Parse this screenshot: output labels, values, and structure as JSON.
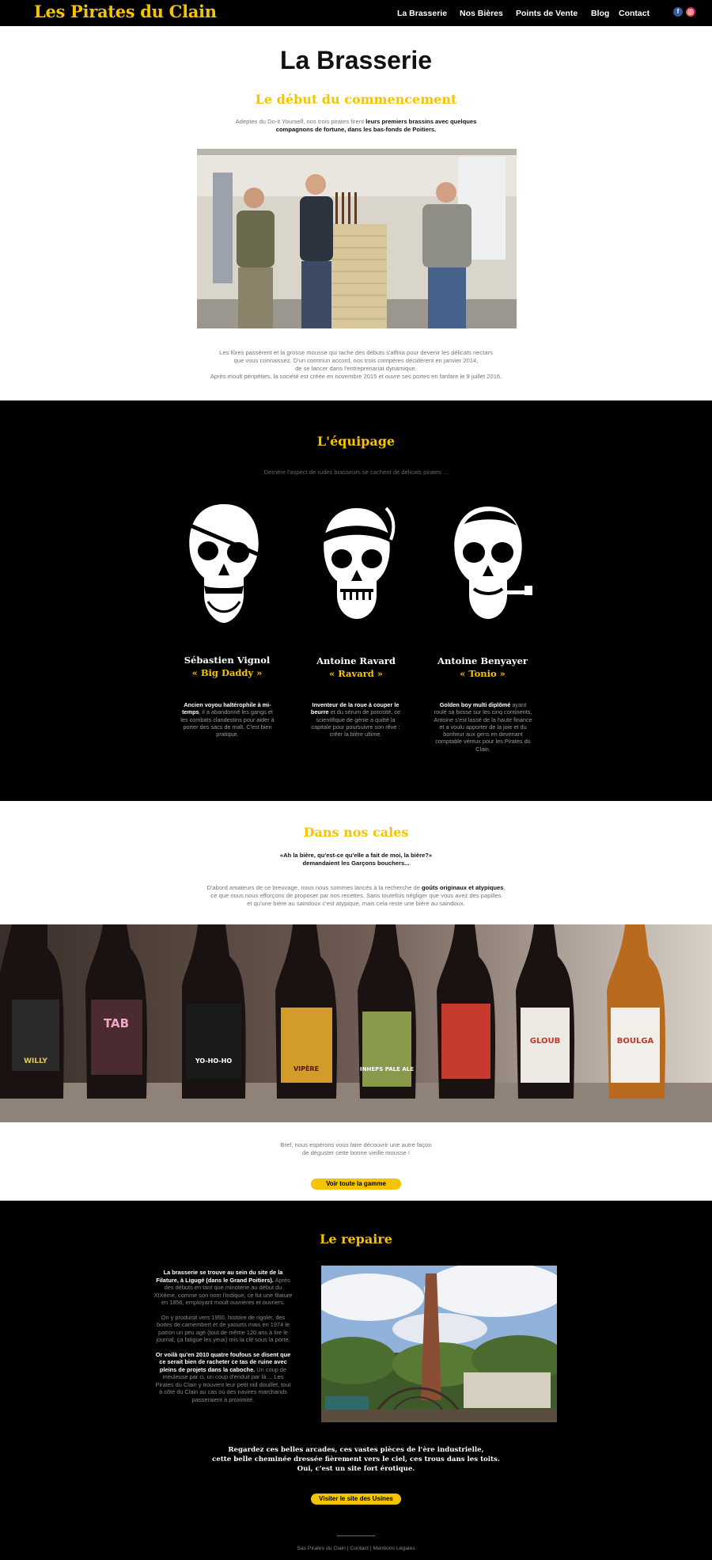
{
  "header": {
    "logo": "Les Pirates du Clain",
    "nav": [
      "La Brasserie",
      "Nos Bières",
      "Points de Vente",
      "Blog",
      "Contact"
    ],
    "social": [
      "facebook-icon",
      "instagram-icon"
    ]
  },
  "brasserie": {
    "title": "La Brasserie",
    "subtitle": "Le début du commencement",
    "intro_a": "Adeptes du Do-it Yourself, nos trois pirates firent ",
    "intro_b": "leurs premiers brassins avec quelques",
    "intro_c": "compagnons de fortune, dans les bas-fonds de Poitiers.",
    "story": [
      "Les fûres passèrent et la grosse mousse qui tache des débuts s'affina pour devenir les délicats nectars",
      "que vous connaissez. D'un commun accord, nos trois compères décidèrent en janvier 2014,",
      "de se lancer dans l'entreprenariat dynamique.",
      "Après moult péripéties, la société est créée en novembre 2015 et ouvre ses portes en fanfare le 9 juillet 2016."
    ]
  },
  "equipage": {
    "title": "L'équipage",
    "subtitle": "Derrière l'aspect de rudes brasseurs se cachent de délicats pirates ...",
    "members": [
      {
        "name": "Sébastien Vignol",
        "nick": "« Big Daddy »",
        "bold": "Ancien voyou haltérophile à mi-temps",
        "desc": ", il a abandonné les gangs et les combats clandestins pour aider à porter des sacs de malt. C'est bien pratique."
      },
      {
        "name": "Antoine Ravard",
        "nick": "« Ravard »",
        "bold": "Inventeur de la roue à couper le beurre",
        "desc": " et du sérum de porosité, ce scientifique de génie a quitté la capitale pour poursuivre son rêve : créer la bière ultime."
      },
      {
        "name": "Antoine Benyayer",
        "nick": "« Tonio »",
        "bold": "Golden boy multi diplômé",
        "desc": " ayant roulé sa bosse sur les cinq continents, Antoine s'est lassé de la haute finance et a voulu apporter de la joie et du bonheur aux gens en devenant comptable véreux pour les Pirates du Clain."
      }
    ]
  },
  "cales": {
    "title": "Dans nos cales",
    "quote_1": "«Ah la bière, qu'est-ce qu'elle a fait de moi, la bière?»",
    "quote_2": "demandaient les Garçons bouchers...",
    "text_a": "D'abord amateurs de ce breuvage, nous nous sommes lancés à la recherche de ",
    "text_b": "goûts originaux et atypiques",
    "text_c": ",",
    "text_2": "ce que nous nous efforçons de proposer par nos recettes. Sans toutefois négliger que vous avez des papilles",
    "text_3": "et qu'une bière au saindoux c'est atypique, mais cela reste une bière au saindoux.",
    "bottles": [
      "WILLY",
      "TAB",
      "YO-HO-HO",
      "VIPÈRE",
      "INHEPS PALE ALE",
      "",
      "GLOUB",
      "BOULGA"
    ],
    "outro_1": "Bref, nous espérons vous faire découvrir une autre façon",
    "outro_2": "de déguster cette bonne vieille mousse !",
    "button": "Voir toute la gamme"
  },
  "repaire": {
    "title": "Le repaire",
    "p1_bold": "La brasserie se trouve au sein du site de la Filature, à Ligugé (dans le Grand Poitiers).",
    "p1": " Après des débuts en tant que minoterie au début du XIXème, comme son nom l'indique, ce fut une filature en 1856, employant moult ouvrières et ouvriers.",
    "p2": "On y produisit vers 1950, histoire de rigoler, des boites de camembert et de yaourts mais en 1974 le patron un peu agé (tout de même 120 ans à lire le journal, ça fatigue les yeux) mis la clé sous la porte.",
    "p3_bold": "Or voilà qu'en 2010 quatre foufous se disent que ce serait bien de racheter ce tas de ruine avec pleins de projets dans la caboche.",
    "p3": " Un coup de meuleuse par ci, un coup d'enduit par là ... Les Pirates du Clain y trouvent leur petit nid douillet, tout à côté du Clain au cas où des navires marchands passeraient à proximité.",
    "quote": [
      "Regardez ces belles arcades, ces vastes pièces de l'ère industrielle,",
      "cette belle cheminée dressée fièrement vers le ciel, ces trous dans les toits.",
      "Oui, c'est un site fort érotique."
    ],
    "button": "Visiter le site des Usines"
  },
  "footer": {
    "links": "Sas Pirates du Clain | Contact | Mentions Légales"
  }
}
